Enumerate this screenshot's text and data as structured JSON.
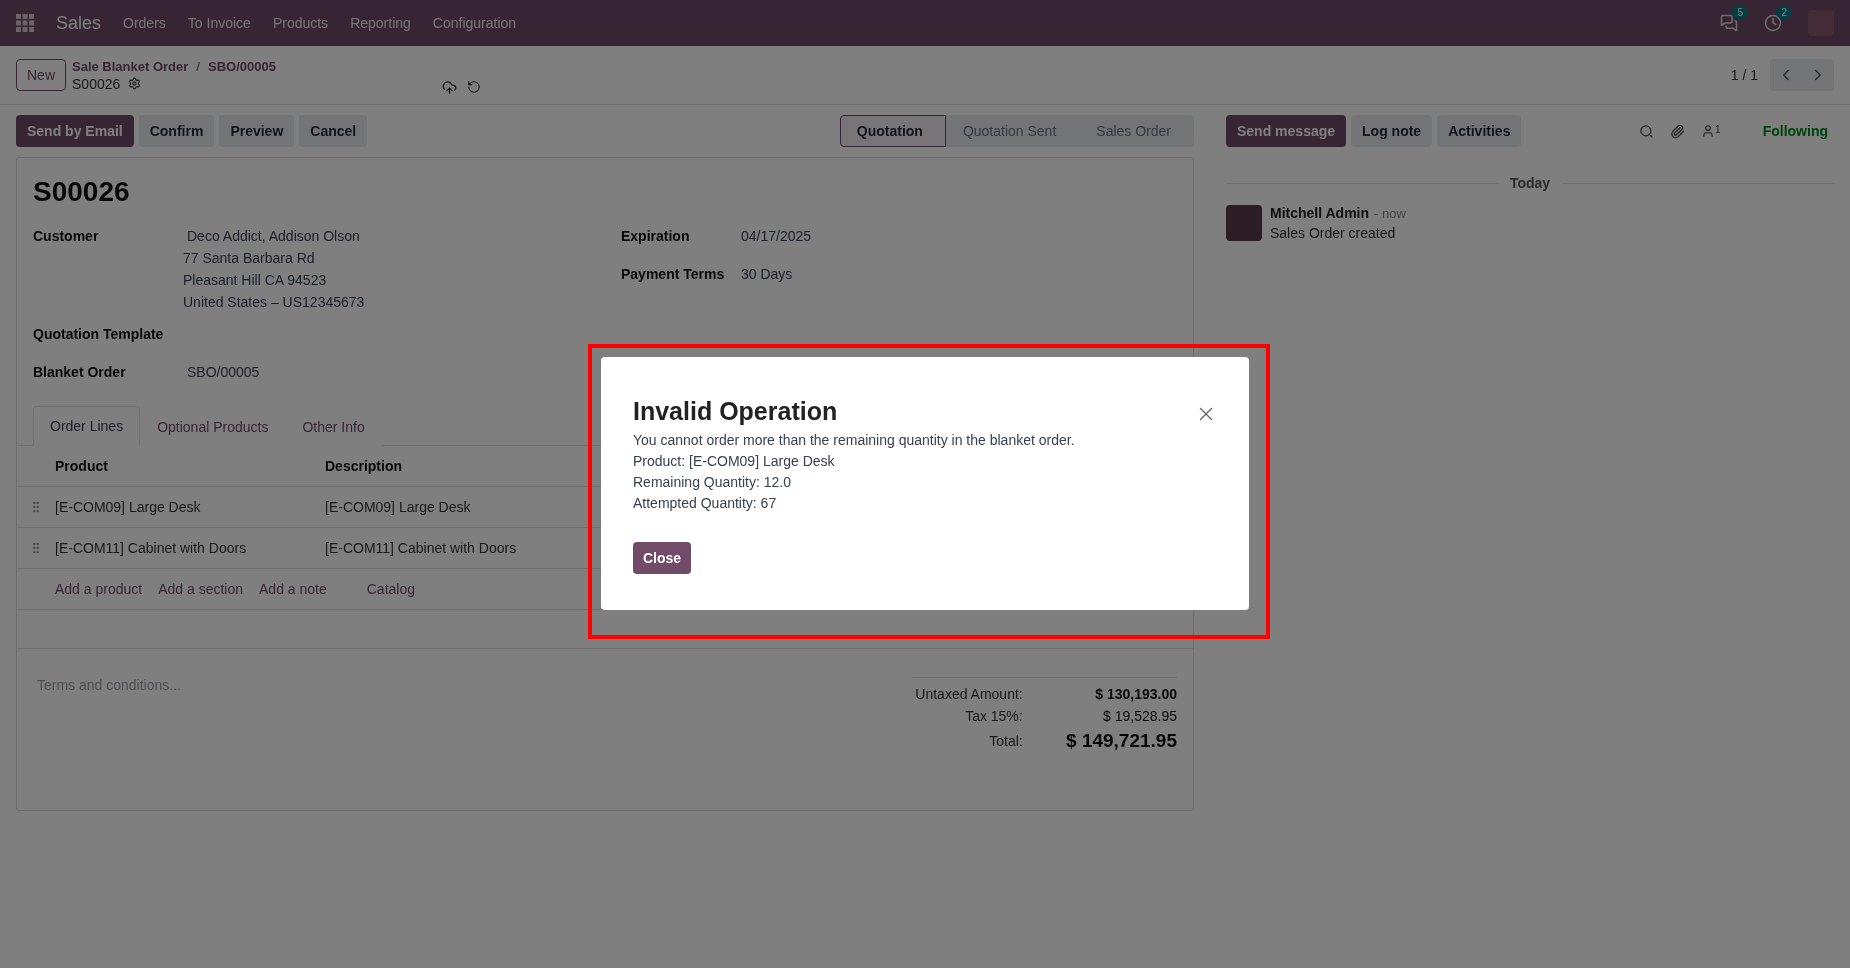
{
  "navbar": {
    "app": "Sales",
    "menu": [
      "Orders",
      "To Invoice",
      "Products",
      "Reporting",
      "Configuration"
    ],
    "messages_count": "5",
    "activities_count": "2"
  },
  "control_panel": {
    "new_button": "New",
    "breadcrumbs": [
      "Sale Blanket Order",
      "SBO/00005"
    ],
    "breadcrumb_separator": "/",
    "record": "S00026",
    "pager": "1 / 1"
  },
  "actions": [
    {
      "label": "Send by Email",
      "primary": true
    },
    {
      "label": "Confirm",
      "primary": false
    },
    {
      "label": "Preview",
      "primary": false
    },
    {
      "label": "Cancel",
      "primary": false
    }
  ],
  "status_bar": [
    {
      "label": "Quotation",
      "selected": true
    },
    {
      "label": "Quotation Sent",
      "selected": false
    },
    {
      "label": "Sales Order",
      "selected": false
    }
  ],
  "form": {
    "title": "S00026",
    "left_fields": [
      {
        "label": "Customer",
        "lines": [
          "Deco Addict, Addison Olson",
          "77 Santa Barbara Rd",
          "Pleasant Hill CA 94523",
          "United States – US12345673"
        ]
      },
      {
        "label": "Quotation Template"
      },
      {
        "label": "Blanket Order",
        "lines": [
          "SBO/00005"
        ]
      }
    ],
    "right_fields": [
      {
        "label": "Expiration",
        "lines": [
          "04/17/2025"
        ]
      },
      {
        "label": "Payment Terms",
        "lines": [
          "30 Days"
        ]
      }
    ],
    "tabs": [
      {
        "label": "Order Lines",
        "selected": true
      },
      {
        "label": "Optional Products",
        "selected": false
      },
      {
        "label": "Other Info",
        "selected": false
      }
    ],
    "table": {
      "columns": [
        "Product",
        "Description"
      ],
      "rows": [
        [
          "[E-COM09] Large Desk",
          "[E-COM09] Large Desk"
        ],
        [
          "[E-COM11] Cabinet with Doors",
          "[E-COM11] Cabinet with Doors"
        ]
      ]
    },
    "add_links": [
      "Add a product",
      "Add a section",
      "Add a note",
      "Catalog"
    ],
    "terms_placeholder": "Terms and conditions...",
    "totals": [
      {
        "label": "Untaxed Amount:",
        "value": "$ 130,193.00",
        "kind": "subtotal"
      },
      {
        "label": "Tax 15%:",
        "value": "$ 19,528.95",
        "kind": "tax"
      },
      {
        "label": "Total:",
        "value": "$ 149,721.95",
        "kind": "total"
      }
    ]
  },
  "chatter": {
    "buttons": [
      {
        "label": "Send message",
        "primary": true
      },
      {
        "label": "Log note",
        "primary": false
      },
      {
        "label": "Activities",
        "primary": false
      }
    ],
    "followers_count": "1",
    "follow_label": "Following",
    "date_separator": "Today",
    "messages": [
      {
        "author": "Mitchell Admin",
        "time": "- now",
        "body": "Sales Order created"
      }
    ]
  },
  "dialog": {
    "title": "Invalid Operation",
    "lines": [
      "You cannot order more than the remaining quantity in the blanket order.",
      "Product: [E-COM09] Large Desk",
      "Remaining Quantity: 12.0",
      "Attempted Quantity: 67"
    ],
    "close_button": "Close"
  }
}
